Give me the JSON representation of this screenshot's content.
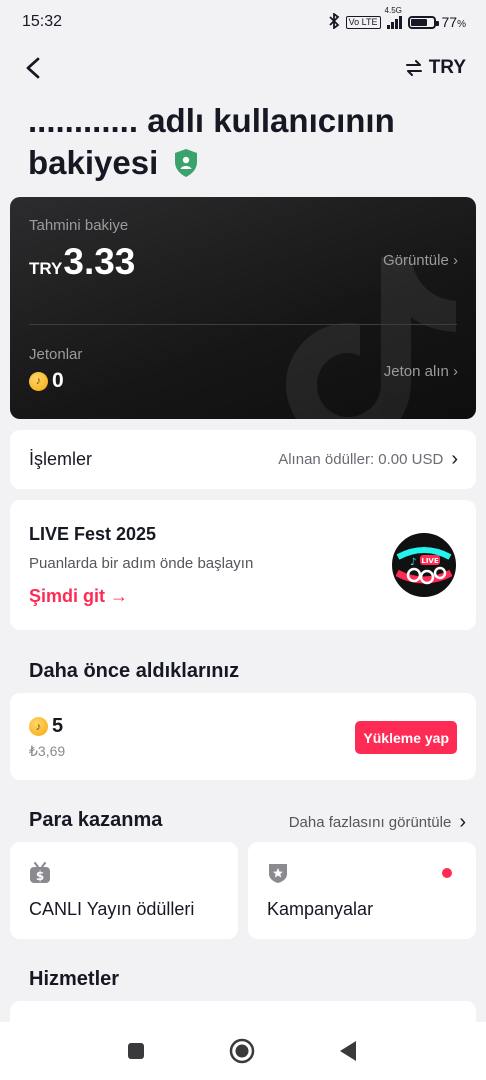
{
  "status_bar": {
    "time": "15:32",
    "network_label": "4.5G",
    "volte_label": "Vo LTE",
    "battery": "77",
    "battery_unit": "%",
    "battery_level": 0.77,
    "icons": [
      "bluetooth-icon",
      "volte-icon",
      "signal-icon",
      "battery-icon"
    ]
  },
  "top_nav": {
    "back_icon": "chevron-left-icon",
    "currency_icon": "swap-arrows-icon",
    "currency_label": "TRY"
  },
  "page": {
    "title": "............ adlı kullanıcının bakiyesi",
    "title_icon": "shield-user-icon",
    "accent_green": "#3aa26b",
    "accent_red": "#fe2c55"
  },
  "balance_card": {
    "estimated_label": "Tahmini bakiye",
    "currency": "TRY",
    "amount": "3.33",
    "view_label": "Görüntüle ›",
    "coins_label": "Jetonlar",
    "coin_count": "0",
    "get_coins_label": "Jeton alın ›"
  },
  "transactions": {
    "title": "İşlemler",
    "rewards_text": "Alınan ödüller: 0.00 USD",
    "chevron": "›"
  },
  "promo": {
    "title": "LIVE Fest 2025",
    "subtitle": "Puanlarda bir adım önde başlayın",
    "link": "Şimdi git →",
    "badge_text": "LIVE"
  },
  "previous": {
    "section_title": "Daha önce aldıklarınız",
    "coin_count": "5",
    "price": "₺3,69",
    "button_label": "Yükleme yap"
  },
  "earn": {
    "section_title": "Para kazanma",
    "see_more": "Daha fazlasını görüntüle",
    "chevron": "›",
    "tiles": [
      {
        "label": "CANLI Yayın ödülleri",
        "icon": "money-tv-icon"
      },
      {
        "label": "Kampanyalar",
        "icon": "badge-star-icon",
        "has_notification": true
      }
    ]
  },
  "services": {
    "section_title": "Hizmetler"
  },
  "system_nav": {
    "buttons": [
      "recents-square-icon",
      "home-circle-icon",
      "back-triangle-icon"
    ]
  }
}
